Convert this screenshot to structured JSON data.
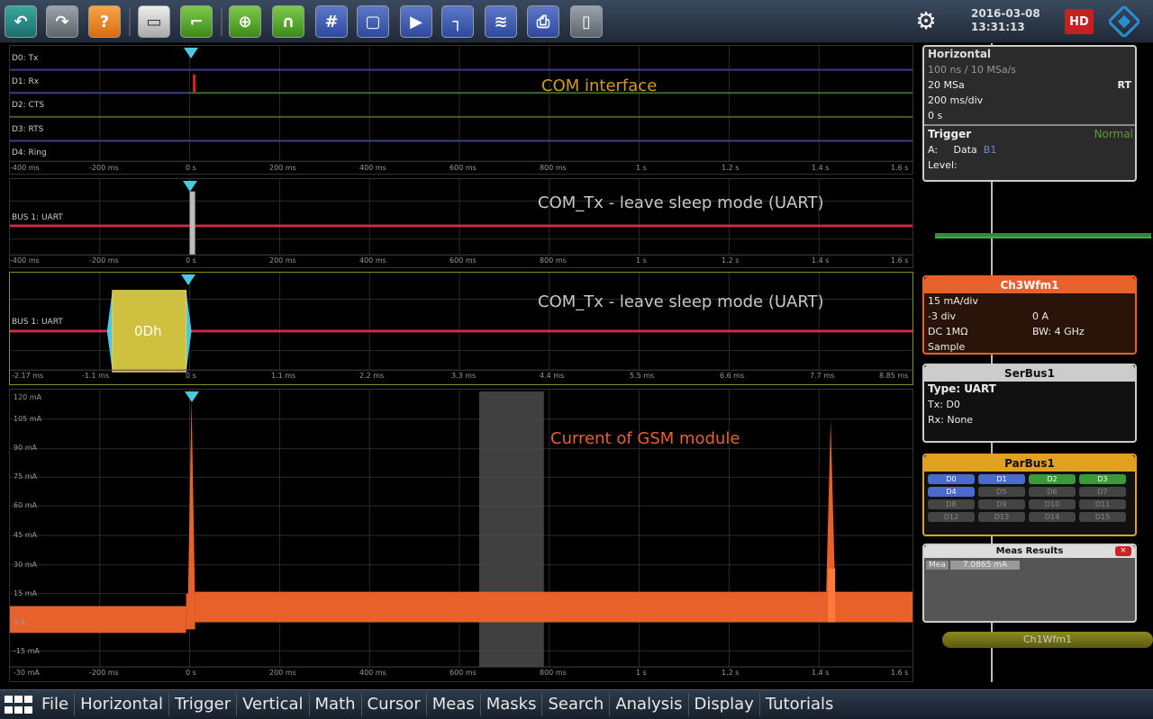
{
  "toolbar": {
    "icons": [
      "undo-icon",
      "redo-icon",
      "help-icon",
      "open-folder-icon",
      "autoset-icon",
      "zoom-icon",
      "find-level-icon",
      "fft-icon",
      "mask-icon",
      "history-icon",
      "cursor-icon",
      "reference-icon",
      "print-icon",
      "delete-icon"
    ],
    "datetime": {
      "date": "2016-03-08",
      "time": "13:31:13"
    },
    "hd_label": "HD",
    "brand_color": "#2a8fd0"
  },
  "diagrams": {
    "logic": {
      "title": "COM interface",
      "channels": [
        "D0: Tx",
        "D1: Rx",
        "D2: CTS",
        "D3: RTS",
        "D4: Ring"
      ],
      "ticks": [
        "-400 ms",
        "-200 ms",
        "0 s",
        "200 ms",
        "400 ms",
        "600 ms",
        "800 ms",
        "1 s",
        "1.2 s",
        "1.4 s",
        "1.6 s"
      ]
    },
    "bus1": {
      "title": "COM_Tx - leave sleep mode (UART)",
      "label": "BUS 1: UART",
      "ticks": [
        "-400 ms",
        "-200 ms",
        "0 s",
        "200 ms",
        "400 ms",
        "600 ms",
        "800 ms",
        "1 s",
        "1.2 s",
        "1.4 s",
        "1.6 s"
      ]
    },
    "bus1_zoom": {
      "title": "COM_Tx - leave sleep mode (UART)",
      "label": "BUS 1: UART",
      "frame_value": "0Dh",
      "ticks": [
        "-2.17 ms",
        "-1.1 ms",
        "0 s",
        "1.1 ms",
        "2.2 ms",
        "3.3 ms",
        "4.4 ms",
        "5.5 ms",
        "6.6 ms",
        "7.7 ms",
        "8.85 ms"
      ]
    },
    "current": {
      "title": "Current of GSM module",
      "y_ticks": [
        "120 mA",
        "105 mA",
        "90 mA",
        "75 mA",
        "60 mA",
        "45 mA",
        "30 mA",
        "15 mA",
        "0 A",
        "-15 mA",
        "-30 mA"
      ],
      "x_ticks": [
        "-400 ms",
        "-200 ms",
        "0 s",
        "200 ms",
        "400 ms",
        "600 ms",
        "800 ms",
        "1 s",
        "1.2 s",
        "1.4 s",
        "1.6 s"
      ]
    }
  },
  "panel": {
    "horizontal": {
      "title": "Horizontal",
      "rows": [
        "100 ns / 10 MSa/s",
        "20 MSa",
        "200 ms/div",
        "0 s"
      ],
      "mode": "RT"
    },
    "trigger": {
      "title": "Trigger",
      "mode": "Normal",
      "source_label": "A:",
      "type": "Data",
      "source": "B1",
      "level_label": "Level:"
    },
    "ch3": {
      "title": "Ch3Wfm1",
      "scale": "15 mA/div",
      "offset": "-3 div",
      "position": "0 A",
      "coupling": "DC 1MΩ",
      "bw": "BW: 4 GHz",
      "acq": "Sample"
    },
    "serbus": {
      "title": "SerBus1",
      "type": "Type: UART",
      "tx": "Tx: D0",
      "rx": "Rx: None"
    },
    "parbus": {
      "title": "ParBus1",
      "bits_row1": [
        "D0",
        "D1",
        "D2",
        "D3"
      ],
      "bits_row2": [
        "D4",
        "D5",
        "D6",
        "D7"
      ],
      "bits_row3": [
        "D8",
        "D9",
        "D10",
        "D11"
      ],
      "bits_row4": [
        "D12",
        "D13",
        "D14",
        "D15"
      ]
    },
    "meas": {
      "title": "Meas Results",
      "name": "Mea",
      "value": "7.0865 mA"
    },
    "ch1": {
      "title": "Ch1Wfm1"
    }
  },
  "menu": [
    "File",
    "Horizontal",
    "Trigger",
    "Vertical",
    "Math",
    "Cursor",
    "Meas",
    "Masks",
    "Search",
    "Analysis",
    "Display",
    "Tutorials"
  ]
}
